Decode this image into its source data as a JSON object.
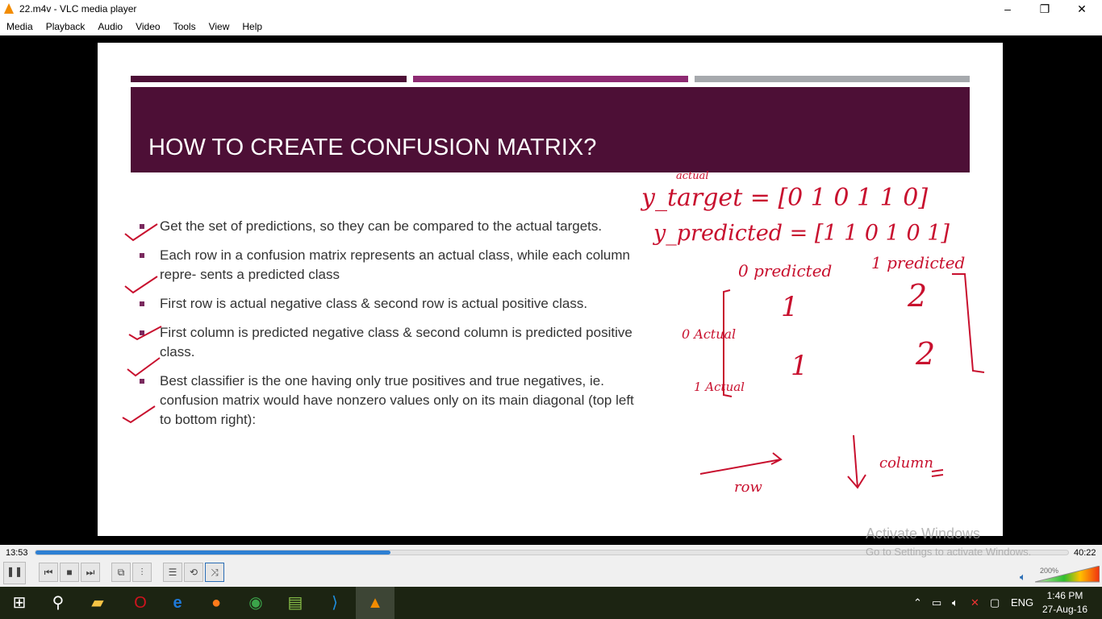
{
  "window": {
    "title": "22.m4v - VLC media player",
    "minimize": "–",
    "maximize": "❐",
    "close": "✕"
  },
  "menu": [
    "Media",
    "Playback",
    "Audio",
    "Video",
    "Tools",
    "View",
    "Help"
  ],
  "slide": {
    "title": "HOW TO CREATE CONFUSION MATRIX?",
    "bars": [
      "#4d0f36",
      "#8e2a72",
      "#a6a9ad"
    ],
    "bullets": [
      "Get the set of predictions, so they can be compared to the actual targets.",
      "Each row in a confusion matrix represents an actual class, while each column repre- sents a predicted class",
      "First row is actual negative class & second row is actual positive class.",
      "First column is predicted negative class & second column is predicted positive class.",
      "Best classifier is the one having only true positives and true negatives, ie. confusion matrix would have nonzero values only on its main diagonal (top left to bottom right):"
    ],
    "handwriting": {
      "actual": "actual",
      "y_target": "y_target = [0 1 0 1 1 0]",
      "y_predicted": "y_predicted = [1 1 0 1 0 1]",
      "col0": "0 predicted",
      "col1": "1 predicted",
      "row0": "0 Actual",
      "row1": "1 Actual",
      "cells": [
        "1",
        "2",
        "1",
        "2"
      ],
      "row": "row",
      "column": "column"
    },
    "ink_color": "#c8102e"
  },
  "watermark": {
    "line1": "Activate Windows",
    "line2": "Go to Settings to activate Windows."
  },
  "player": {
    "elapsed": "13:53",
    "total": "40:22",
    "progress_percent": 34.4,
    "volume": "200%",
    "volume_level_percent": 100
  },
  "taskbar": {
    "apps": [
      "start-icon",
      "search-icon",
      "file-explorer-icon",
      "opera-icon",
      "edge-icon",
      "firefox-icon",
      "chrome-icon",
      "notepad-icon",
      "vscode-icon",
      "vlc-icon"
    ],
    "language": "ENG",
    "time": "1:46 PM",
    "date": "27-Aug-16"
  }
}
